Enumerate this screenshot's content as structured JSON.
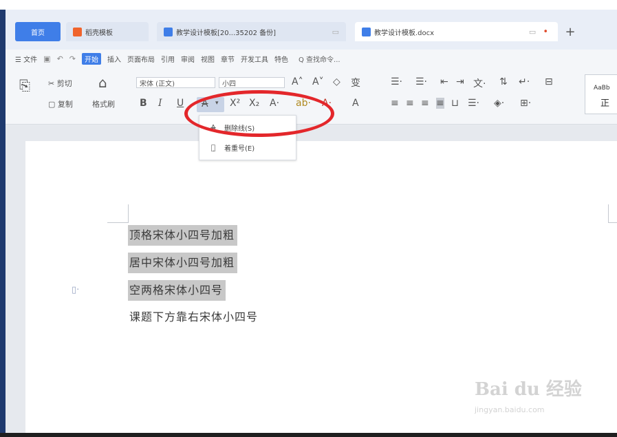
{
  "tabs": {
    "home": "首页",
    "template": "稻壳模板",
    "doc1": "教学设计模板[20...35202 备份]",
    "doc2": "教学设计模板.docx",
    "add": "+"
  },
  "menu": {
    "file": "☰ 文件",
    "start": "开始",
    "items": [
      "插入",
      "页面布局",
      "引用",
      "审阅",
      "视图",
      "章节",
      "开发工具",
      "特色"
    ],
    "search": "Q 查找命令..."
  },
  "ribbon": {
    "cut": "剪切",
    "copy": "复制",
    "format_painter": "格式刷",
    "font_name": "宋体 (正文)",
    "font_size": "小四",
    "bold": "B",
    "italic": "I",
    "underline": "U",
    "strike": "A",
    "superscript": "X²",
    "subscript": "X₂",
    "style_preview_top": "AaBb",
    "style_preview_bottom": "正"
  },
  "dropdown": {
    "item1": "删除线(S)",
    "item2": "着重号(E)"
  },
  "document": {
    "lines": [
      "顶格宋体小四号加粗",
      "居中宋体小四号加粗",
      "空两格宋体小四号",
      "课题下方靠右宋体小四号"
    ]
  },
  "watermark": {
    "brand": "Bai du 经验",
    "url": "jingyan.baidu.com"
  },
  "colors": {
    "accent": "#3f7ee8",
    "annotation": "#e3272b",
    "selection": "#c8c8c8"
  }
}
